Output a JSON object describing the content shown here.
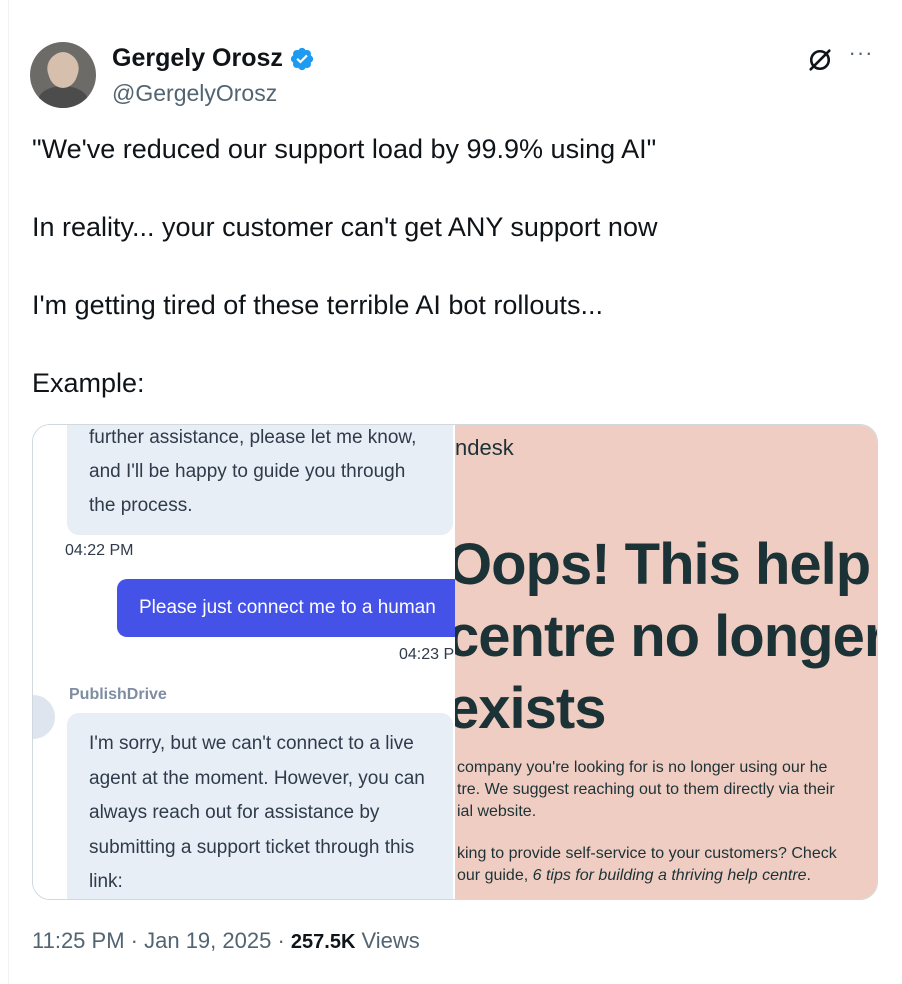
{
  "author": {
    "name": "Gergely Orosz",
    "handle": "@GergelyOrosz"
  },
  "icons": {
    "verified": "verified-badge-icon",
    "grok": "grok-icon",
    "more": "more-options-icon"
  },
  "colors": {
    "verified": "#1d9bf0",
    "user_bubble": "#4452e7",
    "zendesk_bg": "#f0cdc2"
  },
  "tweet": {
    "lines": [
      "\"We've reduced our support load by 99.9% using AI\"",
      "In reality... your customer can't get ANY support now",
      "I'm getting tired of these terrible AI bot rollouts...",
      "Example:"
    ]
  },
  "media": {
    "chat": {
      "bot_message_1": [
        "further assistance, please let me know,",
        "and I'll be happy to guide you through",
        "the process."
      ],
      "time_1": "04:22 PM",
      "user_message": "Please just connect me to a human",
      "time_2": "04:23 P",
      "bot_name": "PublishDrive",
      "bot_message_2": [
        "I'm sorry, but we can't connect to a live",
        "agent at the moment. However, you can",
        "always reach out for assistance by",
        "submitting a support ticket through this",
        "link:"
      ]
    },
    "zendesk": {
      "brand": "ndesk",
      "title_lines": [
        "Oops! This help",
        "centre no longer",
        "exists"
      ],
      "body_lines": [
        "company you're looking for is no longer using our he",
        "tre. We suggest reaching out to them directly via their",
        "ial website."
      ],
      "body2_line1": "king to provide self-service to your customers? Check",
      "body2_prefix": "our guide, ",
      "body2_italic": "6 tips for building a thriving help centre",
      "body2_suffix": "."
    }
  },
  "footer": {
    "time": "11:25 PM",
    "sep1": " · ",
    "date": "Jan 19, 2025",
    "sep2": " · ",
    "views_count": "257.5K",
    "views_label": " Views"
  }
}
